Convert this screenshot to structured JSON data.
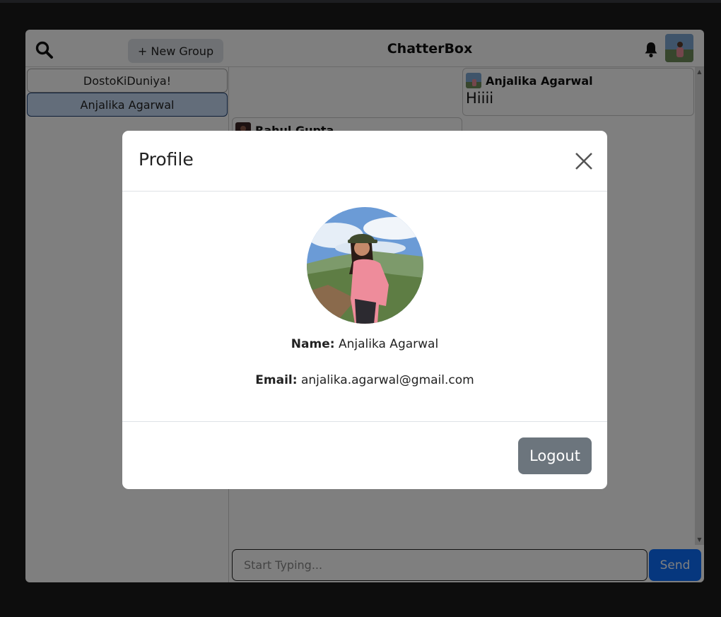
{
  "header": {
    "search_icon": "search-icon",
    "new_group_label": "+ New Group",
    "brand": "ChatterBox",
    "bell_icon": "bell-icon"
  },
  "sidebar": {
    "chats": [
      {
        "name": "DostoKiDuniya!",
        "active": false
      },
      {
        "name": "Anjalika Agarwal",
        "active": true
      }
    ]
  },
  "messages": [
    {
      "sender": "Anjalika Agarwal",
      "text": "Hiiii"
    },
    {
      "sender": "Rahul Gupta",
      "text": ""
    }
  ],
  "composer": {
    "placeholder": "Start Typing...",
    "send_label": "Send"
  },
  "modal": {
    "title": "Profile",
    "name_label": "Name:",
    "name_value": "Anjalika Agarwal",
    "email_label": "Email:",
    "email_value": "anjalika.agarwal@gmail.com",
    "logout_label": "Logout"
  },
  "colors": {
    "accent": "#0d6efd",
    "secondary_button": "#6c757d",
    "active_chat": "#c7dbf4"
  }
}
